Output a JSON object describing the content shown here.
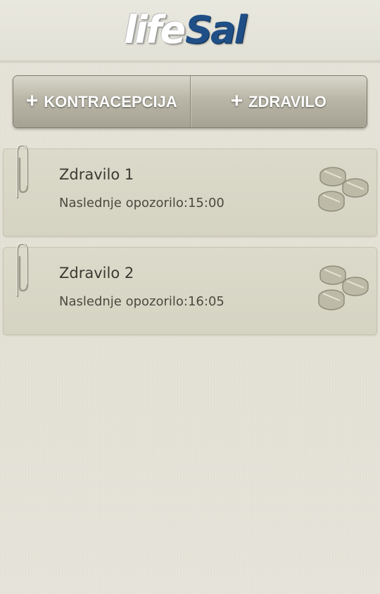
{
  "header": {
    "logo_part1": "life",
    "logo_part2": "Sal",
    "logo_colors": {
      "part1": "#ffffff",
      "part2": "#1f4f86"
    }
  },
  "actions": [
    {
      "icon": "plus-icon",
      "plus": "+",
      "label": "KONTRACEPCIJA"
    },
    {
      "icon": "plus-icon",
      "plus": "+",
      "label": "ZDRAVILO"
    }
  ],
  "medications": [
    {
      "name": "Zdravilo 1",
      "next_reminder": "Naslednje opozorilo:15:00",
      "icon": "pills-icon",
      "decor_icon": "paperclip-icon"
    },
    {
      "name": "Zdravilo 2",
      "next_reminder": "Naslednje opozorilo:16:05",
      "icon": "pills-icon",
      "decor_icon": "paperclip-icon"
    }
  ],
  "colors": {
    "background": "#e4e2d6",
    "card": "#d9d7c6",
    "button": "#b3b0a1",
    "text": "#3a3a32"
  }
}
